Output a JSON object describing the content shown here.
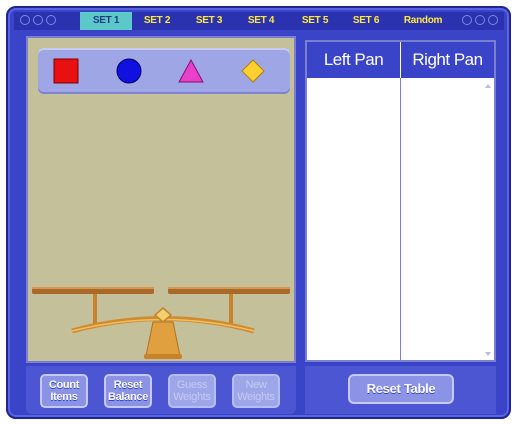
{
  "tabs": [
    {
      "label": "SET 1",
      "active": true
    },
    {
      "label": "SET 2",
      "active": false
    },
    {
      "label": "SET 3",
      "active": false
    },
    {
      "label": "SET 4",
      "active": false
    },
    {
      "label": "SET 5",
      "active": false
    },
    {
      "label": "SET 6",
      "active": false
    },
    {
      "label": "Random",
      "active": false
    }
  ],
  "shapes": [
    {
      "name": "square",
      "color": "#e81010"
    },
    {
      "name": "circle",
      "color": "#1010e0"
    },
    {
      "name": "triangle",
      "color": "#e840c8"
    },
    {
      "name": "diamond",
      "color": "#ffd030"
    }
  ],
  "table": {
    "headers": [
      "Left Pan",
      "Right Pan"
    ],
    "rows": []
  },
  "buttons": {
    "count_items": "Count\nItems",
    "reset_balance": "Reset\nBalance",
    "guess_weights": "Guess\nWeights",
    "new_weights": "New\nWeights",
    "reset_table": "Reset Table"
  },
  "colors": {
    "frame": "#3a44c8",
    "balance_wood": "#a86a28",
    "balance_brass": "#e0a040",
    "panel_bg": "#c3c09a"
  }
}
